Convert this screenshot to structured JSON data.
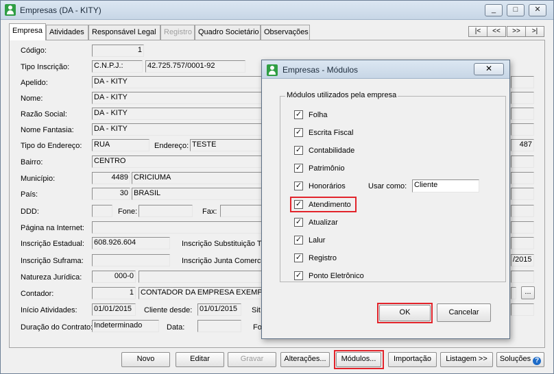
{
  "window": {
    "title": "Empresas (DA - KITY)",
    "min": "_",
    "max": "□",
    "close": "✕"
  },
  "tabs": [
    "Empresa",
    "Atividades",
    "Responsável Legal",
    "Registro",
    "Quadro Societário",
    "Observações"
  ],
  "nav": [
    "|<",
    "<<",
    ">>",
    ">|"
  ],
  "form": {
    "codigo_label": "Código:",
    "codigo": "1",
    "tipo_inscricao_label": "Tipo Inscrição:",
    "tipo_inscricao": "C.N.P.J.:",
    "cnpj": "42.725.757/0001-92",
    "apelido_label": "Apelido:",
    "apelido": "DA - KITY",
    "nome_label": "Nome:",
    "nome": "DA - KITY",
    "razao_label": "Razão Social:",
    "razao": "DA - KITY",
    "fantasia_label": "Nome Fantasia:",
    "fantasia": "DA - KITY",
    "tipo_endereco_label": "Tipo do Endereço:",
    "tipo_endereco": "RUA",
    "endereco_label": "Endereço:",
    "endereco": "TESTE",
    "numero": "487",
    "bairro_label": "Bairro:",
    "bairro": "CENTRO",
    "municipio_label": "Município:",
    "municipio_cod": "4489",
    "municipio": "CRICIUMA",
    "pais_label": "País:",
    "pais_cod": "30",
    "pais": "BRASIL",
    "ddd_label": "DDD:",
    "fone_label": "Fone:",
    "fax_label": "Fax:",
    "pagina_label": "Página na Internet:",
    "ie_label": "Inscrição Estadual:",
    "ie": "608.926.604",
    "ie_subst_label": "Inscrição Substituição Tr",
    "suframa_label": "Inscrição Suframa:",
    "junta_label": "Inscrição Junta Comercial",
    "junta_data": "/2015",
    "natureza_label": "Natureza Jurídica:",
    "natureza": "000-0",
    "contador_label": "Contador:",
    "contador_cod": "1",
    "contador": "CONTADOR DA EMPRESA EXEMPL",
    "contador_btn": "...",
    "inicio_label": "Início Atividades:",
    "inicio": "01/01/2015",
    "cliente_label": "Cliente desde:",
    "cliente": "01/01/2015",
    "sit_label": "Sit",
    "duracao_label": "Duração do Contrato:",
    "duracao": "Indeterminado",
    "data_label": "Data:",
    "fo_label": "Fo"
  },
  "toolbar": {
    "novo": "Novo",
    "editar": "Editar",
    "gravar": "Gravar",
    "alteracoes": "Alterações...",
    "modulos": "Módulos...",
    "importacao": "Importação",
    "listagem": "Listagem >>",
    "soluces": "Soluções",
    "help": "?"
  },
  "modal": {
    "title": "Empresas - Módulos",
    "close": "✕",
    "group_label": "Módulos utilizados pela empresa",
    "modules": [
      {
        "label": "Folha",
        "checked": "✓"
      },
      {
        "label": "Escrita Fiscal",
        "checked": "✓"
      },
      {
        "label": "Contabilidade",
        "checked": "✓"
      },
      {
        "label": "Patrimônio",
        "checked": "✓"
      },
      {
        "label": "Honorários",
        "checked": "✓"
      },
      {
        "label": "Atendimento",
        "checked": "✓"
      },
      {
        "label": "Atualizar",
        "checked": "✓"
      },
      {
        "label": "Lalur",
        "checked": "✓"
      },
      {
        "label": "Registro",
        "checked": "✓"
      },
      {
        "label": "Ponto Eletrônico",
        "checked": "✓"
      }
    ],
    "usar_como_label": "Usar como:",
    "usar_como": "Cliente",
    "ok": "OK",
    "cancel": "Cancelar"
  },
  "colors": {
    "highlight": "#e2232a",
    "titlebar": "#c7d6e6",
    "app_icon": "#2f9e44"
  }
}
